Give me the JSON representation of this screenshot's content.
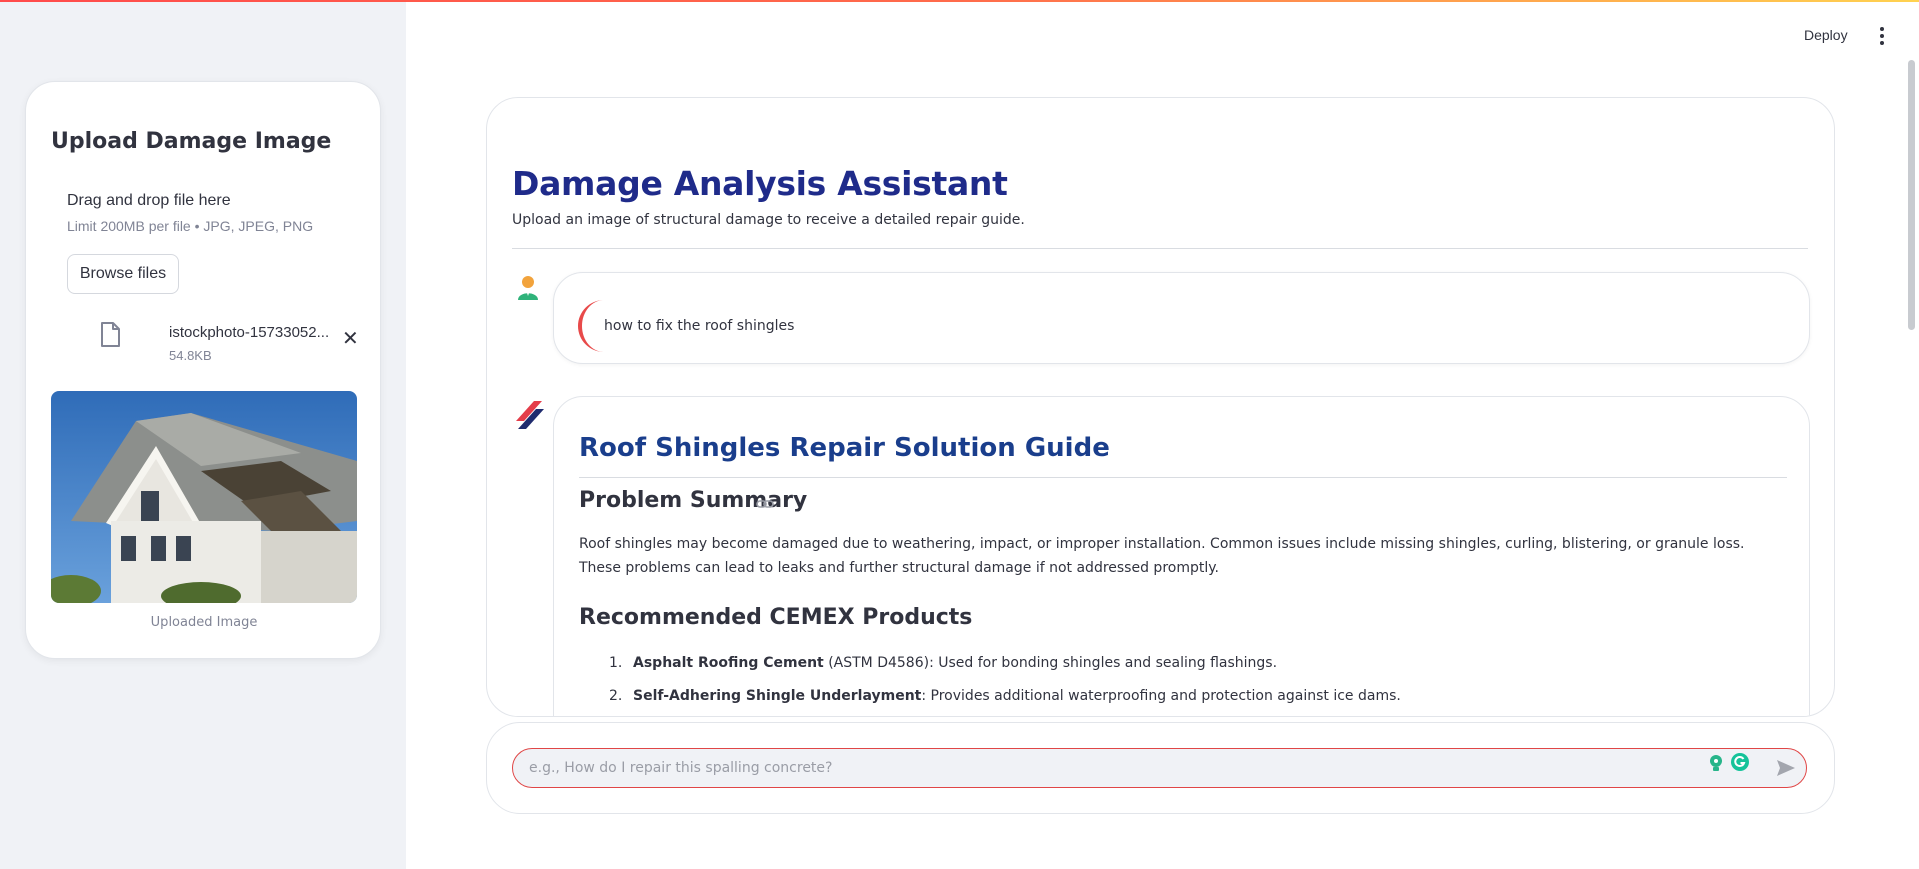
{
  "header": {
    "deploy_label": "Deploy",
    "menu_icon": "vertical-dots-icon"
  },
  "sidebar": {
    "title": "Upload Damage Image",
    "dropzone_title": "Drag and drop file here",
    "dropzone_limit": "Limit 200MB per file • JPG, JPEG, PNG",
    "browse_label": "Browse files",
    "file": {
      "name": "istockphoto-15733052...",
      "size": "54.8KB"
    },
    "image_caption": "Uploaded Image"
  },
  "main": {
    "title": "Damage Analysis Assistant",
    "subtitle": "Upload an image of structural damage to receive a detailed repair guide.",
    "user_message": "how to fix the roof shingles",
    "response": {
      "title": "Roof Shingles Repair Solution Guide",
      "problem_heading": "Problem Summary",
      "problem_text": "Roof shingles may become damaged due to weathering, impact, or improper installation. Common issues include missing shingles, curling, blistering, or granule loss. These problems can lead to leaks and further structural damage if not addressed promptly.",
      "products_heading": "Recommended CEMEX Products",
      "products": [
        {
          "num": "1.",
          "name": "Asphalt Roofing Cement",
          "desc": " (ASTM D4586): Used for bonding shingles and sealing flashings."
        },
        {
          "num": "2.",
          "name": "Self-Adhering Shingle Underlayment",
          "desc": ": Provides additional waterproofing and protection against ice dams."
        }
      ]
    }
  },
  "chat_input": {
    "placeholder": "e.g., How do I repair this spalling concrete?"
  },
  "colors": {
    "accent": "#ff4b4b",
    "title_blue": "#1f2b8a",
    "sidebar_bg": "#f0f2f6"
  }
}
